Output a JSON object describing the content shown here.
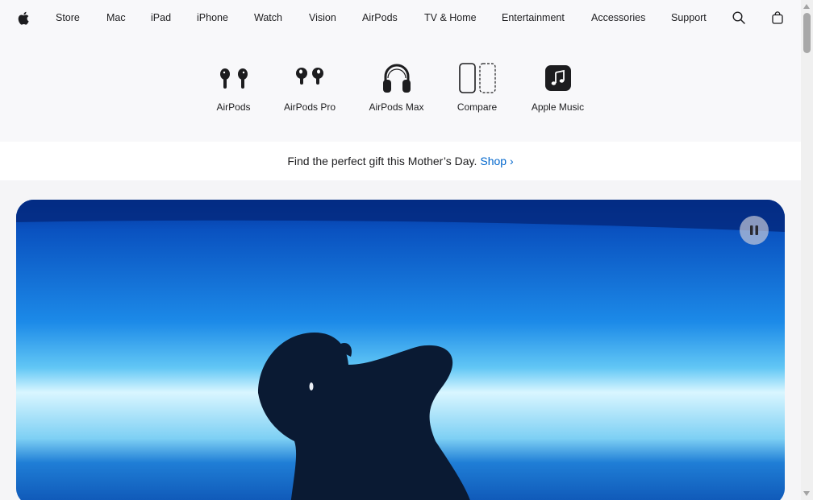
{
  "globalnav": {
    "logo_icon": "apple-logo-icon",
    "items": [
      {
        "label": "Store"
      },
      {
        "label": "Mac"
      },
      {
        "label": "iPad"
      },
      {
        "label": "iPhone"
      },
      {
        "label": "Watch"
      },
      {
        "label": "Vision"
      },
      {
        "label": "AirPods"
      },
      {
        "label": "TV & Home"
      },
      {
        "label": "Entertainment"
      },
      {
        "label": "Accessories"
      },
      {
        "label": "Support"
      }
    ],
    "search_icon": "search-icon",
    "bag_icon": "shopping-bag-icon"
  },
  "chapternav": {
    "items": [
      {
        "label": "AirPods",
        "icon": "airpods-icon"
      },
      {
        "label": "AirPods Pro",
        "icon": "airpods-pro-icon"
      },
      {
        "label": "AirPods Max",
        "icon": "airpods-max-icon"
      },
      {
        "label": "Compare",
        "icon": "compare-icon"
      },
      {
        "label": "Apple Music",
        "icon": "apple-music-icon"
      }
    ]
  },
  "ribbon": {
    "text": "Find the perfect gift this Mother’s Day.",
    "link": "Shop",
    "link_arrow": "›"
  },
  "hero": {
    "pause_icon": "pause-icon"
  },
  "colors": {
    "nav_bg": "#f8f8fa",
    "link": "#0066cc",
    "hero_blue": "#0a5fc4",
    "text": "#1d1d1f"
  }
}
